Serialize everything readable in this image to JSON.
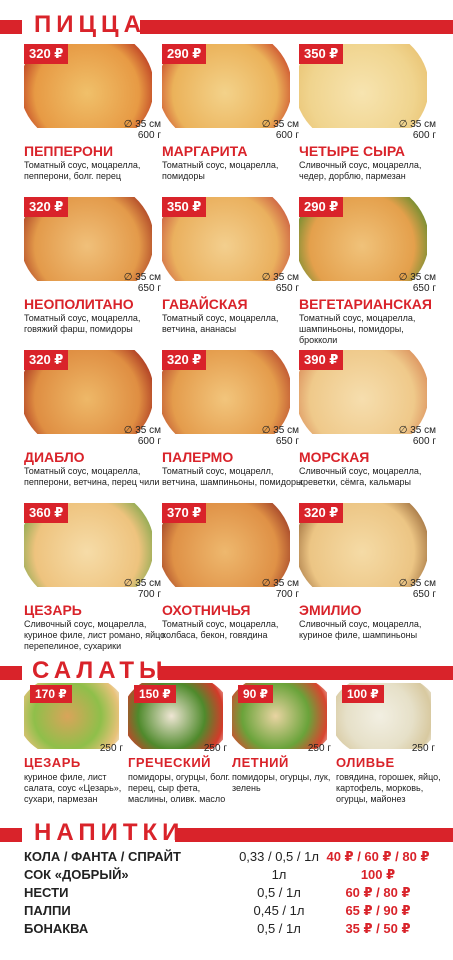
{
  "sections": {
    "pizza_title": "ПИЦЦА",
    "salads_title": "САЛАТЫ",
    "drinks_title": "НАПИТКИ"
  },
  "colors": {
    "accent": "#d9232a"
  },
  "pizzas": [
    {
      "price": "320 ₽",
      "size": "∅ 35 см",
      "weight": "600 г",
      "name": "ПЕППЕРОНИ",
      "desc": "Томатный соус, моцарелла, пепперони, болг. перец"
    },
    {
      "price": "290 ₽",
      "size": "∅ 35 см",
      "weight": "600 г",
      "name": "МАРГАРИТА",
      "desc": "Томатный соус, моцарелла, помидоры"
    },
    {
      "price": "350 ₽",
      "size": "∅ 35 см",
      "weight": "600 г",
      "name": "ЧЕТЫРЕ СЫРА",
      "desc": "Сливочный соус, моцарелла, чедер, дорблю, пармезан"
    },
    {
      "price": "320 ₽",
      "size": "∅ 35 см",
      "weight": "650 г",
      "name": "НЕОПОЛИТАНО",
      "desc": "Томатный соус, моцарелла, говяжий фарш, помидоры"
    },
    {
      "price": "350 ₽",
      "size": "∅ 35 см",
      "weight": "650 г",
      "name": "ГАВАЙСКАЯ",
      "desc": "Томатный соус, моцарелла, ветчина, ананасы"
    },
    {
      "price": "290 ₽",
      "size": "∅ 35 см",
      "weight": "650 г",
      "name": "ВЕГЕТАРИАНСКАЯ",
      "desc": "Томатный соус, моцарелла, шампиньоны, помидоры, брокколи"
    },
    {
      "price": "320 ₽",
      "size": "∅ 35 см",
      "weight": "600 г",
      "name": "ДИАБЛО",
      "desc": "Томатный соус, моцарелла, пепперони, ветчина, перец чили"
    },
    {
      "price": "320 ₽",
      "size": "∅ 35 см",
      "weight": "650 г",
      "name": "ПАЛЕРМО",
      "desc": "Томатный соус, моцарелл, ветчина, шампиньоны, помидоры"
    },
    {
      "price": "390 ₽",
      "size": "∅ 35 см",
      "weight": "600 г",
      "name": "МОРСКАЯ",
      "desc": "Сливочный соус, моцарелла, креветки, сёмга, кальмары"
    },
    {
      "price": "360 ₽",
      "size": "∅ 35 см",
      "weight": "700 г",
      "name": "ЦЕЗАРЬ",
      "desc": "Сливочный соус, моцарелла, куриное филе, лист романо, яйцо перепелиное, сухарики"
    },
    {
      "price": "370 ₽",
      "size": "∅ 35 см",
      "weight": "700 г",
      "name": "ОХОТНИЧЬЯ",
      "desc": "Томатный соус, моцарелла, колбаса, бекон, говядина"
    },
    {
      "price": "320 ₽",
      "size": "∅ 35 см",
      "weight": "650 г",
      "name": "ЭМИЛИО",
      "desc": "Сливочный соус, моцарелла, куриное филе, шампиньоны"
    }
  ],
  "salads": [
    {
      "price": "170 ₽",
      "weight": "250 г",
      "name": "ЦЕЗАРЬ",
      "desc": "куриное филе, лист салата, соус «Цезарь», сухари, пармезан"
    },
    {
      "price": "150 ₽",
      "weight": "250 г",
      "name": "ГРЕЧЕСКИЙ",
      "desc": "помидоры, огурцы, болг. перец, сыр фета, маслины, оливк. масло"
    },
    {
      "price": "90 ₽",
      "weight": "250 г",
      "name": "ЛЕТНИЙ",
      "desc": "помидоры, огурцы, лук, зелень"
    },
    {
      "price": "100 ₽",
      "weight": "250 г",
      "name": "ОЛИВЬЕ",
      "desc": "говядина, горошек, яйцо, картофель, морковь, огурцы, майонез"
    }
  ],
  "drinks": [
    {
      "name": "КОЛА / ФАНТА / СПРАЙТ",
      "volume": "0,33 / 0,5 / 1л",
      "price": "40 ₽ / 60 ₽ / 80 ₽"
    },
    {
      "name": "СОК «ДОБРЫЙ»",
      "volume": "1л",
      "price": "100 ₽"
    },
    {
      "name": "НЕСТИ",
      "volume": "0,5 / 1л",
      "price": "60 ₽ / 80 ₽"
    },
    {
      "name": "ПАЛПИ",
      "volume": "0,45 / 1л",
      "price": "65 ₽ / 90 ₽"
    },
    {
      "name": "БОНАКВА",
      "volume": "0,5 / 1л",
      "price": "35 ₽ / 50 ₽"
    }
  ]
}
